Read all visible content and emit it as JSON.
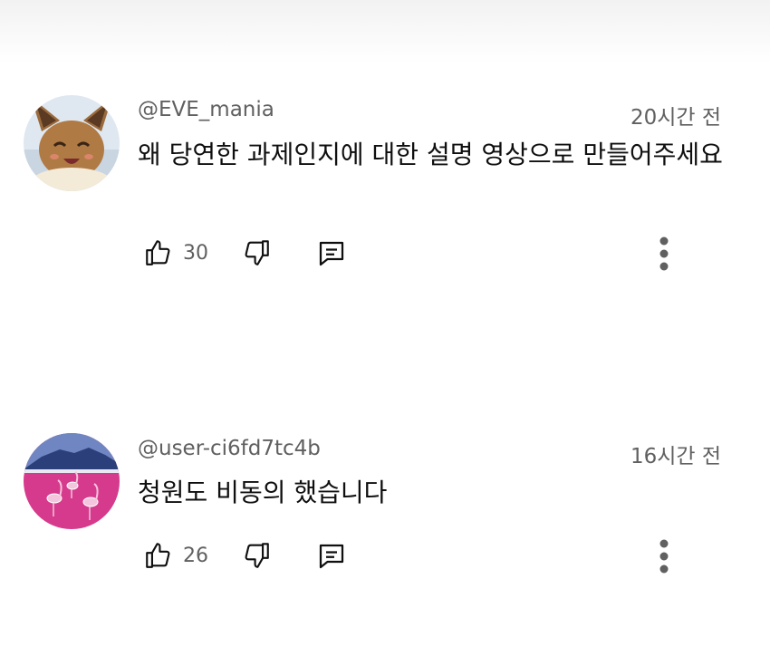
{
  "comments": [
    {
      "handle": "@EVE_mania",
      "time": "20시간 전",
      "text": "왜 당연한 과제인지에 대한 설명 영상으로 만들어주세요",
      "likes": "30",
      "avatar_icon": "eevee-avatar"
    },
    {
      "handle": "@user-ci6fd7tc4b",
      "time": "16시간 전",
      "text": "청원도 비동의 했습니다",
      "likes": "26",
      "avatar_icon": "flamingo-avatar"
    }
  ],
  "colors": {
    "secondary_text": "#606060",
    "primary_text": "#0f0f0f",
    "icon": "#0f0f0f"
  }
}
